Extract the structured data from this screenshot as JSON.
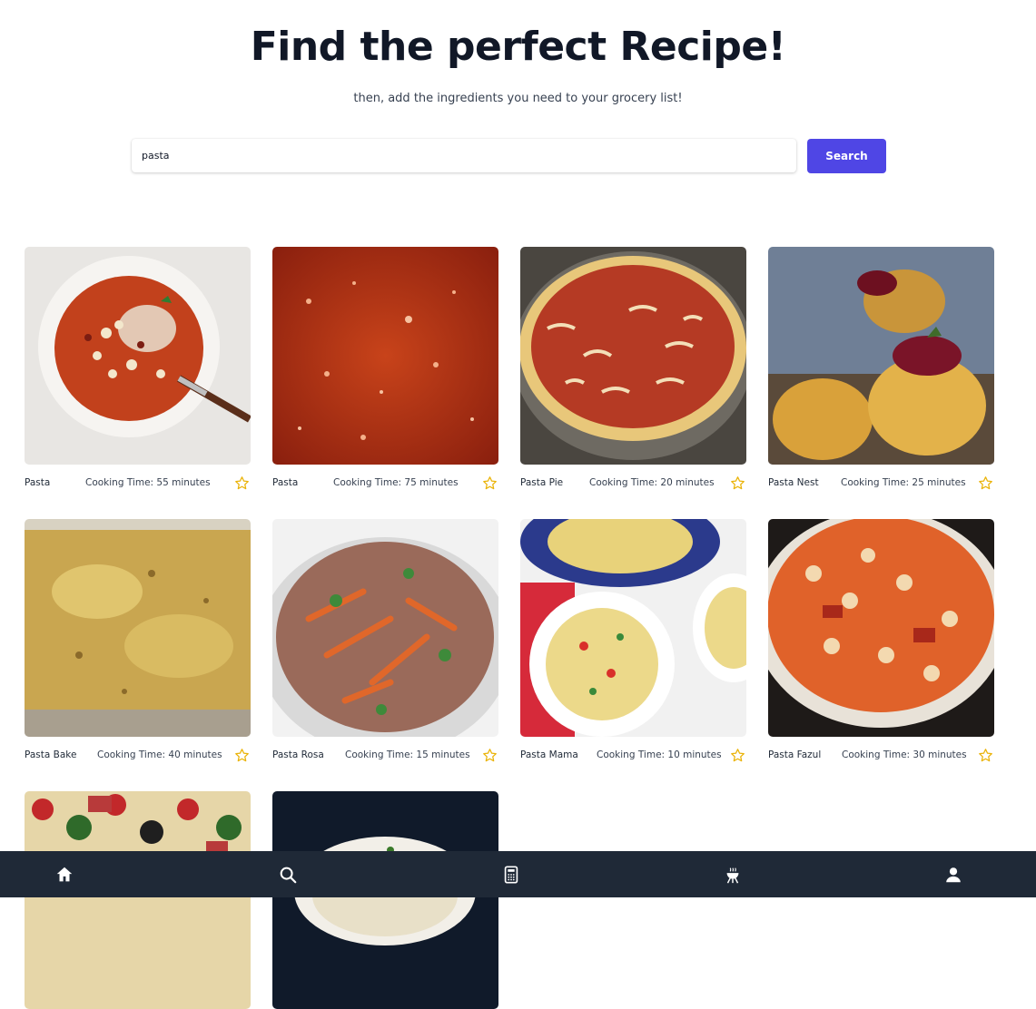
{
  "header": {
    "title": "Find the perfect Recipe!",
    "subtitle": "then, add the ingredients you need to your grocery list!"
  },
  "search": {
    "value": "pasta",
    "placeholder": "",
    "button_label": "Search"
  },
  "recipes": [
    {
      "title": "Pasta",
      "time": "Cooking Time: 55 minutes",
      "image": "tomato-pasta-soup-photo"
    },
    {
      "title": "Pasta",
      "time": "Cooking Time: 75 minutes",
      "image": "red-sauce-closeup-photo"
    },
    {
      "title": "Pasta Pie",
      "time": "Cooking Time: 20 minutes",
      "image": "spaghetti-pie-photo"
    },
    {
      "title": "Pasta Nest",
      "time": "Cooking Time: 25 minutes",
      "image": "pasta-nest-cranberry-photo"
    },
    {
      "title": "Pasta Bake",
      "time": "Cooking Time: 40 minutes",
      "image": "cheesy-pasta-bake-photo"
    },
    {
      "title": "Pasta Rosa",
      "time": "Cooking Time: 15 minutes",
      "image": "pasta-rosa-carrots-photo"
    },
    {
      "title": "Pasta Mama",
      "time": "Cooking Time: 10 minutes",
      "image": "spaghetti-bowls-photo"
    },
    {
      "title": "Pasta Fazul",
      "time": "Cooking Time: 30 minutes",
      "image": "pasta-fazool-beans-photo"
    },
    {
      "title": "",
      "time": "",
      "image": "pasta-salad-photo"
    },
    {
      "title": "",
      "time": "",
      "image": "white-pasta-bowl-photo"
    }
  ],
  "icons": {
    "favorite": "star-outline-icon",
    "nav": [
      "home-icon",
      "search-icon",
      "calculator-icon",
      "grill-icon",
      "user-icon"
    ]
  },
  "colors": {
    "accent": "#4f46e5",
    "nav_background": "#1f2937",
    "star": "#eab308",
    "title": "#111827"
  }
}
